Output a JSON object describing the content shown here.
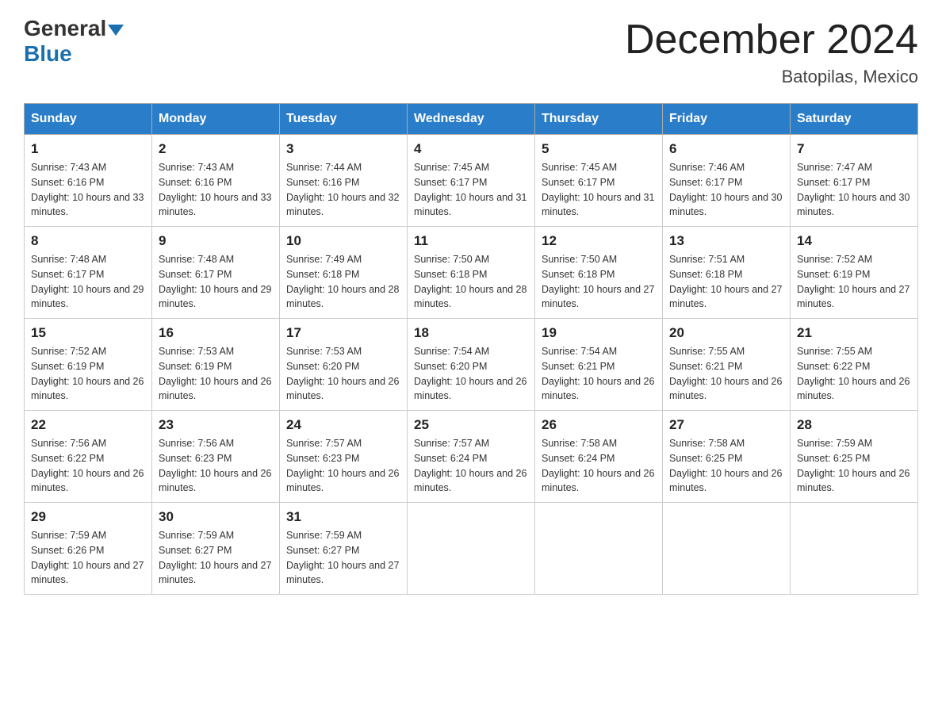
{
  "header": {
    "logo_text_general": "General",
    "logo_text_blue": "Blue",
    "month_title": "December 2024",
    "subtitle": "Batopilas, Mexico"
  },
  "weekdays": [
    "Sunday",
    "Monday",
    "Tuesday",
    "Wednesday",
    "Thursday",
    "Friday",
    "Saturday"
  ],
  "weeks": [
    [
      {
        "day": "1",
        "sunrise": "7:43 AM",
        "sunset": "6:16 PM",
        "daylight": "10 hours and 33 minutes."
      },
      {
        "day": "2",
        "sunrise": "7:43 AM",
        "sunset": "6:16 PM",
        "daylight": "10 hours and 33 minutes."
      },
      {
        "day": "3",
        "sunrise": "7:44 AM",
        "sunset": "6:16 PM",
        "daylight": "10 hours and 32 minutes."
      },
      {
        "day": "4",
        "sunrise": "7:45 AM",
        "sunset": "6:17 PM",
        "daylight": "10 hours and 31 minutes."
      },
      {
        "day": "5",
        "sunrise": "7:45 AM",
        "sunset": "6:17 PM",
        "daylight": "10 hours and 31 minutes."
      },
      {
        "day": "6",
        "sunrise": "7:46 AM",
        "sunset": "6:17 PM",
        "daylight": "10 hours and 30 minutes."
      },
      {
        "day": "7",
        "sunrise": "7:47 AM",
        "sunset": "6:17 PM",
        "daylight": "10 hours and 30 minutes."
      }
    ],
    [
      {
        "day": "8",
        "sunrise": "7:48 AM",
        "sunset": "6:17 PM",
        "daylight": "10 hours and 29 minutes."
      },
      {
        "day": "9",
        "sunrise": "7:48 AM",
        "sunset": "6:17 PM",
        "daylight": "10 hours and 29 minutes."
      },
      {
        "day": "10",
        "sunrise": "7:49 AM",
        "sunset": "6:18 PM",
        "daylight": "10 hours and 28 minutes."
      },
      {
        "day": "11",
        "sunrise": "7:50 AM",
        "sunset": "6:18 PM",
        "daylight": "10 hours and 28 minutes."
      },
      {
        "day": "12",
        "sunrise": "7:50 AM",
        "sunset": "6:18 PM",
        "daylight": "10 hours and 27 minutes."
      },
      {
        "day": "13",
        "sunrise": "7:51 AM",
        "sunset": "6:18 PM",
        "daylight": "10 hours and 27 minutes."
      },
      {
        "day": "14",
        "sunrise": "7:52 AM",
        "sunset": "6:19 PM",
        "daylight": "10 hours and 27 minutes."
      }
    ],
    [
      {
        "day": "15",
        "sunrise": "7:52 AM",
        "sunset": "6:19 PM",
        "daylight": "10 hours and 26 minutes."
      },
      {
        "day": "16",
        "sunrise": "7:53 AM",
        "sunset": "6:19 PM",
        "daylight": "10 hours and 26 minutes."
      },
      {
        "day": "17",
        "sunrise": "7:53 AM",
        "sunset": "6:20 PM",
        "daylight": "10 hours and 26 minutes."
      },
      {
        "day": "18",
        "sunrise": "7:54 AM",
        "sunset": "6:20 PM",
        "daylight": "10 hours and 26 minutes."
      },
      {
        "day": "19",
        "sunrise": "7:54 AM",
        "sunset": "6:21 PM",
        "daylight": "10 hours and 26 minutes."
      },
      {
        "day": "20",
        "sunrise": "7:55 AM",
        "sunset": "6:21 PM",
        "daylight": "10 hours and 26 minutes."
      },
      {
        "day": "21",
        "sunrise": "7:55 AM",
        "sunset": "6:22 PM",
        "daylight": "10 hours and 26 minutes."
      }
    ],
    [
      {
        "day": "22",
        "sunrise": "7:56 AM",
        "sunset": "6:22 PM",
        "daylight": "10 hours and 26 minutes."
      },
      {
        "day": "23",
        "sunrise": "7:56 AM",
        "sunset": "6:23 PM",
        "daylight": "10 hours and 26 minutes."
      },
      {
        "day": "24",
        "sunrise": "7:57 AM",
        "sunset": "6:23 PM",
        "daylight": "10 hours and 26 minutes."
      },
      {
        "day": "25",
        "sunrise": "7:57 AM",
        "sunset": "6:24 PM",
        "daylight": "10 hours and 26 minutes."
      },
      {
        "day": "26",
        "sunrise": "7:58 AM",
        "sunset": "6:24 PM",
        "daylight": "10 hours and 26 minutes."
      },
      {
        "day": "27",
        "sunrise": "7:58 AM",
        "sunset": "6:25 PM",
        "daylight": "10 hours and 26 minutes."
      },
      {
        "day": "28",
        "sunrise": "7:59 AM",
        "sunset": "6:25 PM",
        "daylight": "10 hours and 26 minutes."
      }
    ],
    [
      {
        "day": "29",
        "sunrise": "7:59 AM",
        "sunset": "6:26 PM",
        "daylight": "10 hours and 27 minutes."
      },
      {
        "day": "30",
        "sunrise": "7:59 AM",
        "sunset": "6:27 PM",
        "daylight": "10 hours and 27 minutes."
      },
      {
        "day": "31",
        "sunrise": "7:59 AM",
        "sunset": "6:27 PM",
        "daylight": "10 hours and 27 minutes."
      },
      null,
      null,
      null,
      null
    ]
  ],
  "labels": {
    "sunrise_prefix": "Sunrise: ",
    "sunset_prefix": "Sunset: ",
    "daylight_prefix": "Daylight: "
  }
}
